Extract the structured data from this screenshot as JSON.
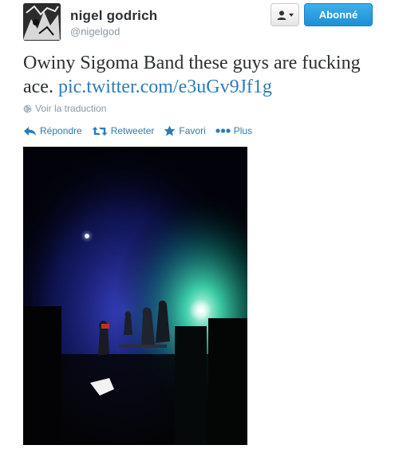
{
  "user": {
    "name": "nigel godrich",
    "handle": "@nigelgod"
  },
  "buttons": {
    "follow_label": "Abonné",
    "user_menu_icon": "person-dropdown-icon"
  },
  "tweet": {
    "text": "Owiny Sigoma Band these guys are fucking ace.",
    "link": "pic.twitter.com/e3uGv9Jf1g"
  },
  "translate_label": "Voir la traduction",
  "actions": {
    "reply": "Répondre",
    "retweet": "Retweeter",
    "favorite": "Favori",
    "more": "Plus"
  },
  "colors": {
    "link": "#2b7bb9",
    "follow_button": "#1e8fd6",
    "muted": "#8899a6"
  }
}
